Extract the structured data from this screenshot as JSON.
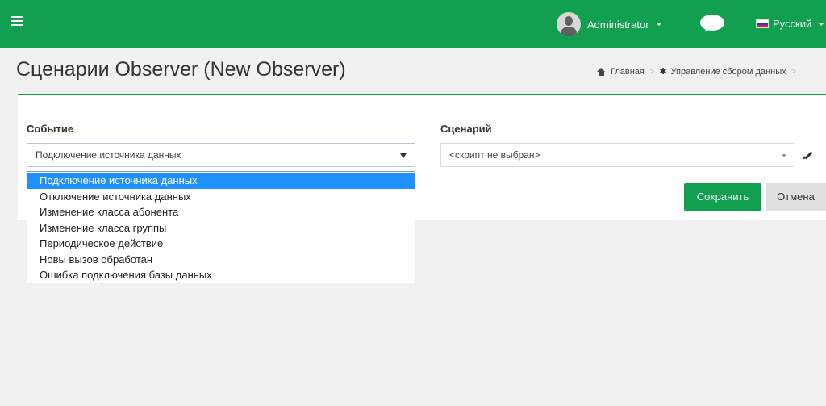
{
  "topbar": {
    "user_name": "Administrator",
    "language": "Русский"
  },
  "page": {
    "title": "Сценарии Observer (New Observer)"
  },
  "breadcrumb": {
    "home": "Главная",
    "section": "Управление сбором данных"
  },
  "form": {
    "event_label": "Событие",
    "event_value": "Подключение источника данных",
    "script_label": "Сценарий",
    "script_value": "<скрипт не выбран>",
    "save_label": "Сохранить",
    "cancel_label": "Отмена"
  },
  "dropdown": {
    "selected_index": 0,
    "options": [
      "Подключение источника данных",
      "Отключение источника данных",
      "Изменение класса абонента",
      "Изменение класса группы",
      "Периодическое действие",
      "Новы вызов обработан",
      "Ошибка подключения базы данных"
    ]
  },
  "colors": {
    "brand": "#10a050",
    "selection": "#1e90ff"
  },
  "icons": [
    "hamburger-icon",
    "user-avatar-icon",
    "chevron-down-icon",
    "chat-icon",
    "russia-flag-icon",
    "home-icon",
    "cog-icon",
    "pencil-icon"
  ]
}
